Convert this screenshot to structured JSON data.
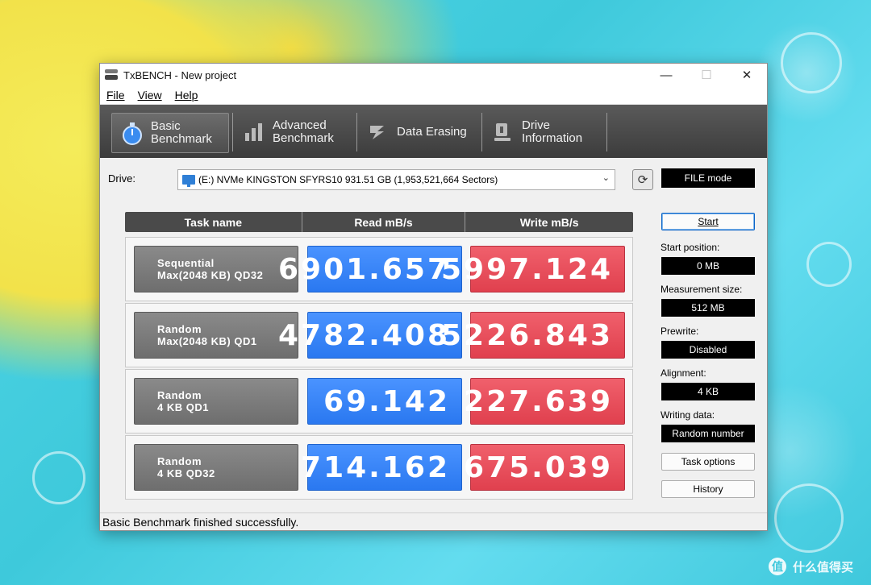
{
  "window": {
    "title": "TxBENCH - New project"
  },
  "menu": [
    "File",
    "View",
    "Help"
  ],
  "tabs": [
    {
      "line1": "Basic",
      "line2": "Benchmark",
      "icon": "stopwatch-icon",
      "active": true
    },
    {
      "line1": "Advanced",
      "line2": "Benchmark",
      "icon": "bar-chart-icon",
      "active": false
    },
    {
      "line1": "Data Erasing",
      "line2": "",
      "icon": "eraser-icon",
      "active": false
    },
    {
      "line1": "Drive",
      "line2": "Information",
      "icon": "drive-info-icon",
      "active": false
    }
  ],
  "drive": {
    "label": "Drive:",
    "selected": "(E:) NVMe KINGSTON SFYRS10  931.51 GB (1,953,521,664 Sectors)"
  },
  "grid": {
    "headers": {
      "task": "Task name",
      "read": "Read mB/s",
      "write": "Write mB/s"
    },
    "rows": [
      {
        "task_line1": "Sequential",
        "task_line2": "Max(2048 KB) QD32",
        "read": "6901.657",
        "write": "5997.124"
      },
      {
        "task_line1": "Random",
        "task_line2": "Max(2048 KB) QD1",
        "read": "4782.408",
        "write": "5226.843"
      },
      {
        "task_line1": "Random",
        "task_line2": "4 KB QD1",
        "read": "69.142",
        "write": "227.639"
      },
      {
        "task_line1": "Random",
        "task_line2": "4 KB QD32",
        "read": "714.162",
        "write": "675.039"
      }
    ]
  },
  "side": {
    "mode": "FILE mode",
    "start_button": "Start",
    "start_position_label": "Start position:",
    "start_position": "0 MB",
    "measurement_size_label": "Measurement size:",
    "measurement_size": "512 MB",
    "prewrite_label": "Prewrite:",
    "prewrite": "Disabled",
    "alignment_label": "Alignment:",
    "alignment": "4 KB",
    "writing_data_label": "Writing data:",
    "writing_data": "Random number",
    "task_options_button": "Task options",
    "history_button": "History"
  },
  "status": "Basic Benchmark finished successfully.",
  "watermark": "什么值得买",
  "colors": {
    "read": "#2f7ef5",
    "write": "#e84a58",
    "toolbar": "#4a4a4a"
  }
}
